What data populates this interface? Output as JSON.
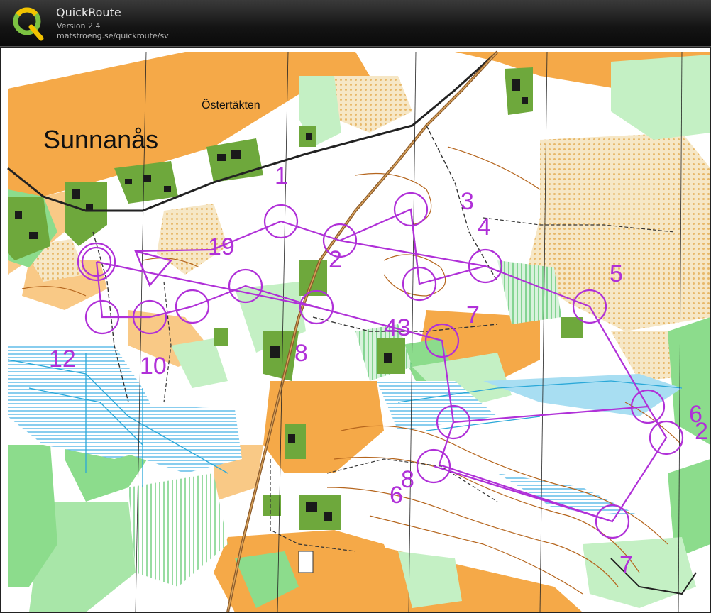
{
  "app": {
    "title": "QuickRoute",
    "version": "Version 2.4",
    "url": "matstroeng.se/quickroute/sv",
    "logo_letter": "Q"
  },
  "map": {
    "place_large": "Sunnanås",
    "place_small": "Östertäkten",
    "course_color": "#b030d8",
    "control_labels": [
      "1",
      "19",
      "2",
      "3",
      "4",
      "5",
      "6",
      "7",
      "8",
      "10",
      "12",
      "43",
      "6",
      "8",
      "2",
      "7"
    ]
  }
}
